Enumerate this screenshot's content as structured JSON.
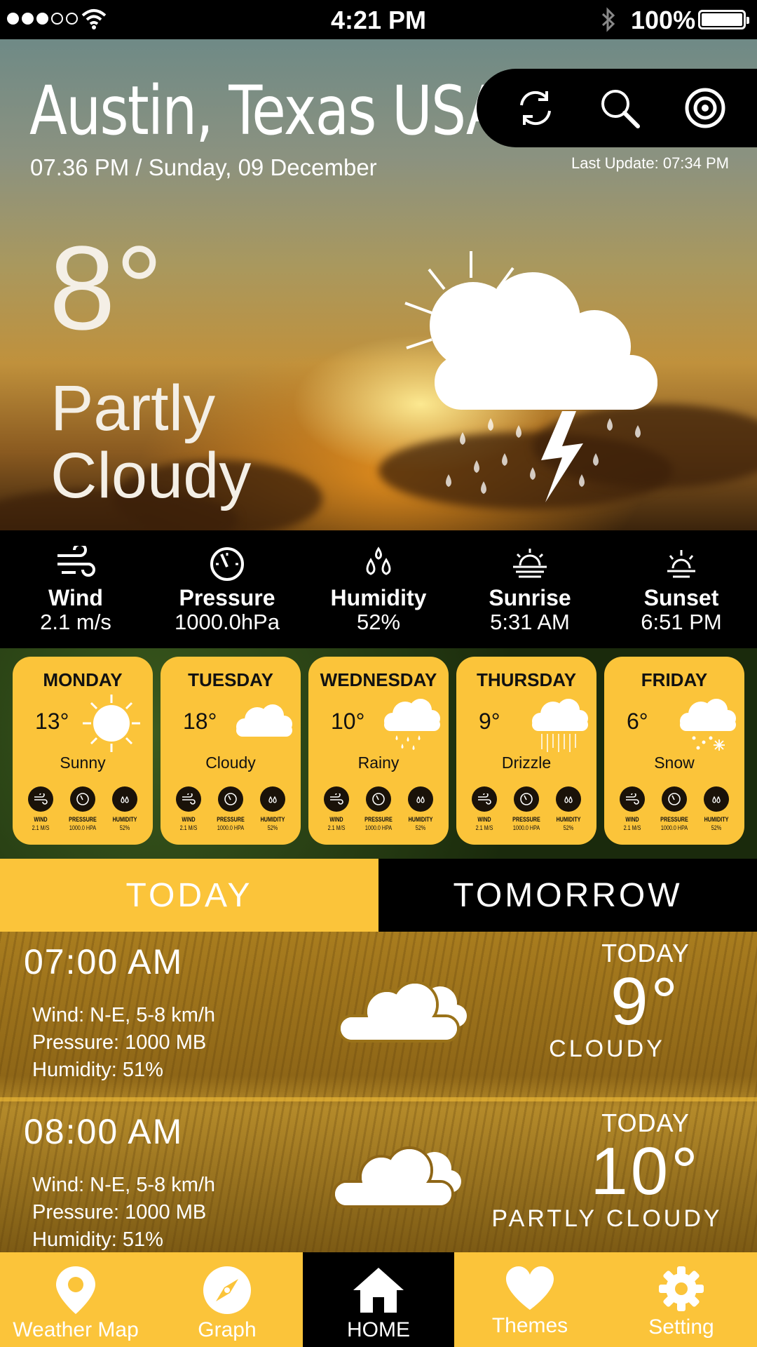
{
  "status_bar": {
    "time": "4:21 PM",
    "battery": "100%"
  },
  "header": {
    "city": "Austin, Texas USA",
    "datetime": "07.36 PM / Sunday, 09 December",
    "last_update": "Last Update: 07:34 PM"
  },
  "current": {
    "temp": "8°",
    "condition_line1": "Partly",
    "condition_line2": "Cloudy"
  },
  "stats": [
    {
      "label": "Wind",
      "value": "2.1 m/s",
      "icon": "wind-icon"
    },
    {
      "label": "Pressure",
      "value": "1000.0hPa",
      "icon": "gauge-icon"
    },
    {
      "label": "Humidity",
      "value": "52%",
      "icon": "droplets-icon"
    },
    {
      "label": "Sunrise",
      "value": "5:31 AM",
      "icon": "sunrise-icon"
    },
    {
      "label": "Sunset",
      "value": "6:51 PM",
      "icon": "sunset-icon"
    }
  ],
  "forecast": [
    {
      "day": "MONDAY",
      "temp": "13°",
      "condition": "Sunny"
    },
    {
      "day": "TUESDAY",
      "temp": "18°",
      "condition": "Cloudy"
    },
    {
      "day": "WEDNESDAY",
      "temp": "10°",
      "condition": "Rainy"
    },
    {
      "day": "THURSDAY",
      "temp": "9°",
      "condition": "Drizzle"
    },
    {
      "day": "FRIDAY",
      "temp": "6°",
      "condition": "Snow"
    }
  ],
  "mini_stats": {
    "wind_label": "WIND",
    "wind_value": "2.1 M/S",
    "pressure_label": "PRESSURE",
    "pressure_value": "1000.0 HPA",
    "humidity_label": "HUMIDITY",
    "humidity_value": "52%"
  },
  "tabs": {
    "today": "TODAY",
    "tomorrow": "TOMORROW"
  },
  "hourly": [
    {
      "time": "07:00 AM",
      "wind": "Wind: N-E, 5-8 km/h",
      "pressure": "Pressure: 1000 MB",
      "humidity": "Humidity: 51%",
      "day": "TODAY",
      "temp": "9°",
      "condition": "CLOUDY"
    },
    {
      "time": "08:00 AM",
      "wind": "Wind: N-E, 5-8 km/h",
      "pressure": "Pressure: 1000 MB",
      "humidity": "Humidity: 51%",
      "day": "TODAY",
      "temp": "10°",
      "condition": "PARTLY CLOUDY"
    }
  ],
  "nav": [
    {
      "label": "Weather Map",
      "icon": "map-pin-icon"
    },
    {
      "label": "Graph",
      "icon": "compass-icon"
    },
    {
      "label": "HOME",
      "icon": "home-icon"
    },
    {
      "label": "Themes",
      "icon": "heart-icon"
    },
    {
      "label": "Setting",
      "icon": "gear-icon"
    }
  ],
  "colors": {
    "accent": "#fbc43a",
    "dark": "#000000"
  }
}
